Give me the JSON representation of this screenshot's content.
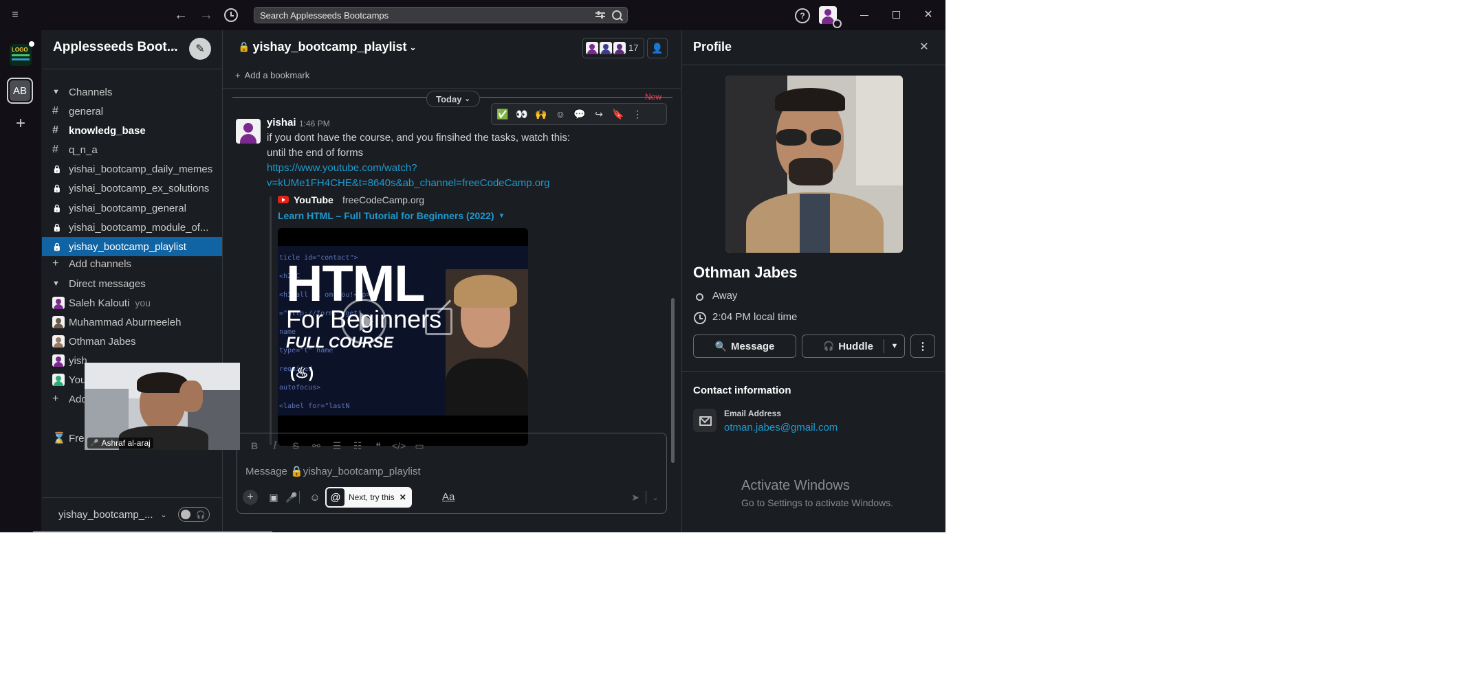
{
  "search": {
    "placeholder": "Search Applesseeds Bootcamps"
  },
  "workspace": {
    "name": "Applesseeds Boot...",
    "rail_badge": "AB",
    "logo_text": "LOGO"
  },
  "sidebar": {
    "channels_header": "Channels",
    "channels": [
      {
        "name": "general",
        "type": "public",
        "bold": false,
        "selected": false
      },
      {
        "name": "knowledg_base",
        "type": "public",
        "bold": true,
        "selected": false
      },
      {
        "name": "q_n_a",
        "type": "public",
        "bold": false,
        "selected": false
      },
      {
        "name": "yishai_bootcamp_daily_memes",
        "type": "private",
        "bold": false,
        "selected": false
      },
      {
        "name": "yishai_bootcamp_ex_solutions",
        "type": "private",
        "bold": false,
        "selected": false
      },
      {
        "name": "yishai_bootcamp_general",
        "type": "private",
        "bold": false,
        "selected": false
      },
      {
        "name": "yishai_bootcamp_module_of...",
        "type": "private",
        "bold": false,
        "selected": false
      },
      {
        "name": "yishay_bootcamp_playlist",
        "type": "private",
        "bold": false,
        "selected": true
      }
    ],
    "add_channels": "Add channels",
    "dm_header": "Direct messages",
    "dms": [
      {
        "name": "Saleh Kalouti",
        "suffix": "you"
      },
      {
        "name": "Muhammad Aburmeeleh",
        "suffix": ""
      },
      {
        "name": "Othman Jabes",
        "suffix": ""
      },
      {
        "name": "yish",
        "suffix": ""
      },
      {
        "name": "You",
        "suffix": ""
      }
    ],
    "add_coworkers": "Add",
    "free_trial": "Free trial in progress",
    "footer_channel": "yishay_bootcamp_..."
  },
  "huddle_video": {
    "name": "Ashraf al-araj"
  },
  "chat": {
    "title": "yishay_bootcamp_playlist",
    "member_count": "17",
    "add_bookmark": "Add a bookmark",
    "date_divider": "Today",
    "new_label": "New",
    "message": {
      "author": "yishai",
      "time": "1:46 PM",
      "line1": "if you dont have the course, and you finsihed the tasks, watch this:",
      "line2": "until the end of forms",
      "link_line1": "https://www.youtube.com/watch?",
      "link_line2": "v=kUMe1FH4CHE&t=8640s&ab_channel=freeCodeCamp.org",
      "embed_source": "YouTube",
      "embed_channel": "freeCodeCamp.org",
      "embed_title": "Learn HTML – Full Tutorial for Beginners (2022)",
      "thumb_title": "HTML",
      "thumb_subtitle": "For Beginners",
      "thumb_course": "FULL COURSE",
      "thumb_code": [
        "ticle id=\"contact\">",
        "<h2>C",
        "<h3>all  1i  om you!</p>",
        "=\"http://form.  /get\"",
        "name",
        "type=\"t\"  name",
        "required",
        "autofocus>",
        "<label for=\"lastN"
      ]
    },
    "reactions": [
      "✅",
      "👀",
      "🙌"
    ],
    "composer_placeholder": "Message 🔒yishay_bootcamp_playlist",
    "next_tip": "Next, try this"
  },
  "profile": {
    "header": "Profile",
    "name": "Othman Jabes",
    "status": "Away",
    "local_time": "2:04 PM local time",
    "message_btn": "Message",
    "huddle_btn": "Huddle",
    "contact_header": "Contact information",
    "email_label": "Email Address",
    "email": "otman.jabes@gmail.com"
  },
  "watermark": {
    "line1": "Activate Windows",
    "line2": "Go to Settings to activate Windows."
  },
  "colors": {
    "bg": "#1a1d21",
    "selected": "#1164a3",
    "link": "#1d9bd1",
    "new": "#e8485d",
    "online": "#2bac76"
  }
}
